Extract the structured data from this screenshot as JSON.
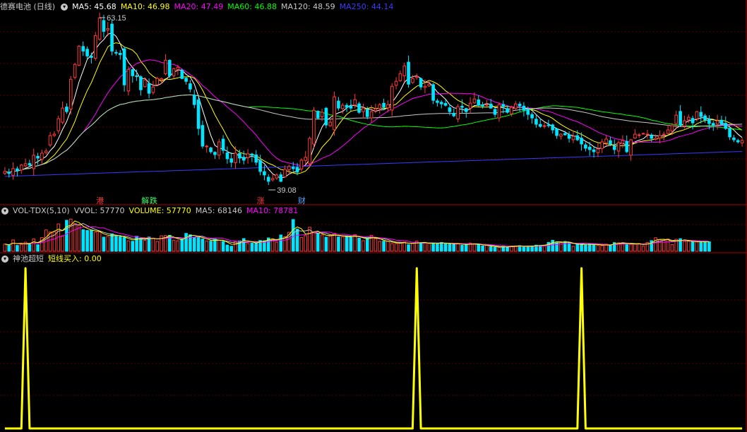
{
  "price_header": {
    "stock_title": "德赛电池 (日线)",
    "ma_items": [
      {
        "label": "MA5: 45.68",
        "color": "#ffffff"
      },
      {
        "label": "MA10: 46.98",
        "color": "#ffff00"
      },
      {
        "label": "MA20: 47.49",
        "color": "#ff00ff"
      },
      {
        "label": "MA60: 46.88",
        "color": "#00ff00"
      },
      {
        "label": "MA120: 48.59",
        "color": "#c8c8c8"
      },
      {
        "label": "MA250: 44.14",
        "color": "#3a3aff"
      }
    ]
  },
  "price_annotations": {
    "high": "63.15",
    "low": "39.08"
  },
  "events": [
    {
      "label": "港",
      "color": "#ff3333",
      "bar": 23
    },
    {
      "label": "解",
      "color": "#33ff66",
      "bar": 34
    },
    {
      "label": "跌",
      "color": "#33ff66",
      "bar": 36
    },
    {
      "label": "涨",
      "color": "#ff3333",
      "bar": 62
    },
    {
      "label": "财",
      "color": "#4da6ff",
      "bar": 72
    }
  ],
  "volume_header": {
    "name": "VOL-TDX(5,10)",
    "items": [
      {
        "label": "VVOL: 57770",
        "color": "#c8c8c8"
      },
      {
        "label": "VOLUME: 57770",
        "color": "#ffff00"
      },
      {
        "label": "MA5: 68146",
        "color": "#c8c8c8"
      },
      {
        "label": "MA10: 78781",
        "color": "#ff00ff"
      }
    ]
  },
  "signal_header": {
    "name": "神池超短",
    "items": [
      {
        "label": "短线买入: 0.00",
        "color": "#ffff00"
      }
    ]
  },
  "colors": {
    "up": "#ff3b3b",
    "down": "#00e5ff",
    "signal": "#ffff00",
    "grid": "#5a0000",
    "divider": "#aa0000"
  },
  "chart_data": [
    {
      "type": "candlestick",
      "title": "德赛电池 (日线)",
      "bar_count": 174,
      "ylim": [
        39.08,
        63.15
      ],
      "close": [
        41.3,
        41.0,
        41.7,
        41.4,
        42.2,
        42.4,
        42.2,
        43.6,
        43.2,
        43.9,
        44.2,
        46.4,
        46.6,
        48.8,
        50.3,
        49.8,
        54.4,
        56.5,
        59.1,
        58.4,
        57.7,
        57.5,
        60.6,
        63.1,
        61.2,
        61.6,
        58.4,
        58.2,
        57.9,
        53.6,
        55.8,
        54.9,
        54.8,
        52.9,
        54.3,
        52.4,
        53.3,
        54.5,
        54.5,
        57.1,
        54.9,
        55.9,
        56.1,
        54.5,
        54.1,
        53.0,
        50.8,
        47.4,
        44.9,
        44.9,
        44.1,
        43.7,
        45.5,
        44.3,
        43.1,
        42.6,
        43.9,
        43.2,
        42.9,
        43.8,
        43.6,
        42.6,
        41.3,
        40.8,
        39.9,
        40.3,
        40.8,
        39.9,
        41.6,
        42.0,
        41.7,
        41.2,
        42.9,
        43.3,
        46.0,
        50.0,
        48.9,
        49.7,
        47.9,
        48.3,
        51.9,
        50.3,
        50.7,
        50.4,
        50.3,
        51.5,
        49.7,
        50.3,
        49.1,
        49.8,
        50.2,
        50.8,
        50.4,
        50.8,
        53.4,
        54.1,
        55.2,
        56.3,
        53.7,
        54.5,
        54.8,
        53.3,
        53.4,
        53.7,
        51.4,
        51.1,
        50.9,
        50.7,
        49.8,
        49.2,
        50.5,
        50.4,
        49.8,
        51.0,
        51.6,
        50.7,
        50.6,
        50.8,
        50.3,
        49.4,
        50.8,
        50.5,
        49.7,
        50.4,
        50.9,
        50.6,
        50.0,
        49.4,
        48.9,
        48.0,
        47.7,
        47.8,
        47.8,
        47.2,
        46.4,
        46.6,
        46.5,
        46.0,
        46.3,
        45.8,
        45.2,
        44.6,
        44.4,
        44.1,
        44.5,
        45.5,
        45.9,
        45.2,
        44.4,
        45.4,
        45.7,
        44.1,
        45.8,
        46.6,
        46.5,
        46.7,
        46.6,
        46.0,
        46.0,
        46.4,
        46.6,
        47.2,
        47.8,
        49.3,
        47.9,
        48.5,
        49.0,
        48.2,
        49.8,
        49.1,
        48.6,
        48.1,
        47.9,
        48.5,
        48.0,
        47.4,
        46.2,
        45.8,
        45.5,
        45.7
      ],
      "volume": [
        10400,
        8800,
        16600,
        8600,
        10100,
        13300,
        10100,
        18200,
        9600,
        20000,
        31200,
        28100,
        28500,
        40000,
        22700,
        45300,
        47100,
        40500,
        38100,
        31600,
        30400,
        31100,
        27800,
        28200,
        20700,
        21600,
        25500,
        21900,
        21100,
        20000,
        15300,
        14600,
        21900,
        19000,
        16100,
        20800,
        19000,
        14500,
        22600,
        23000,
        23300,
        16200,
        15400,
        18400,
        26100,
        24100,
        19600,
        22000,
        17900,
        15100,
        14800,
        17800,
        16300,
        14400,
        9100,
        7400,
        14000,
        15100,
        18600,
        11400,
        12100,
        12800,
        15800,
        15400,
        19500,
        18300,
        13300,
        23800,
        21200,
        27700,
        46400,
        32400,
        20000,
        22800,
        35100,
        26900,
        26500,
        23800,
        20600,
        23400,
        26200,
        20900,
        20800,
        22100,
        20500,
        24400,
        19100,
        15500,
        19400,
        23300,
        18500,
        14600,
        14800,
        14700,
        11400,
        11300,
        13000,
        13400,
        9600,
        11600,
        14700,
        11500,
        12600,
        11400,
        11400,
        12100,
        12900,
        11100,
        10700,
        10900,
        11600,
        8800,
        9800,
        12100,
        10500,
        9700,
        7900,
        8800,
        6800,
        6000,
        5900,
        7100,
        6500,
        7800,
        7900,
        8200,
        6300,
        7700,
        7800,
        9000,
        8500,
        9000,
        13000,
        16100,
        12600,
        12600,
        14300,
        12900,
        7300,
        11900,
        10200,
        9200,
        10600,
        10400,
        8800,
        8300,
        10400,
        8900,
        12700,
        12400,
        12400,
        10900,
        10200,
        10800,
        11400,
        7600,
        12900,
        15500,
        19800,
        16900,
        15700,
        18100,
        9800,
        17500,
        18400,
        14600,
        14700,
        14000,
        13800,
        13900,
        14100,
        13900
      ],
      "ma": {
        "MA5": 45.68,
        "MA10": 46.98,
        "MA20": 47.49,
        "MA60": 46.88,
        "MA120": 48.59,
        "MA250": 44.14
      }
    },
    {
      "type": "line",
      "title": "神池超短",
      "series": [
        {
          "name": "短线买入",
          "spikes_at_bars": [
            5,
            100,
            140
          ],
          "value_last": 0.0
        }
      ]
    }
  ]
}
